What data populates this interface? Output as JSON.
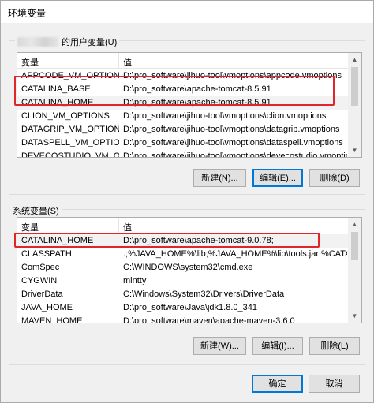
{
  "window": {
    "title": "环境变量"
  },
  "user_section": {
    "group_label": "的用户变量(U)",
    "columns": [
      "变量",
      "值"
    ],
    "rows": [
      {
        "name": "APPCODE_VM_OPTIONS",
        "value": "D:\\pro_software\\jihuo-tool\\vmoptions\\appcode.vmoptions"
      },
      {
        "name": "CATALINA_BASE",
        "value": "D:\\pro_software\\apache-tomcat-8.5.91"
      },
      {
        "name": "CATALINA_HOME",
        "value": "D:\\pro_software\\apache-tomcat-8.5.91"
      },
      {
        "name": "CLION_VM_OPTIONS",
        "value": "D:\\pro_software\\jihuo-tool\\vmoptions\\clion.vmoptions"
      },
      {
        "name": "DATAGRIP_VM_OPTIONS",
        "value": "D:\\pro_software\\jihuo-tool\\vmoptions\\datagrip.vmoptions"
      },
      {
        "name": "DATASPELL_VM_OPTIONS",
        "value": "D:\\pro_software\\jihuo-tool\\vmoptions\\dataspell.vmoptions"
      },
      {
        "name": "DEVECOSTUDIO_VM_OPT...",
        "value": "D:\\pro_software\\jihuo-tool\\vmoptions\\devecostudio.vmoptions"
      }
    ],
    "buttons": {
      "new": "新建(N)...",
      "edit": "编辑(E)...",
      "delete": "删除(D)"
    }
  },
  "system_section": {
    "group_label": "系统变量(S)",
    "columns": [
      "变量",
      "值"
    ],
    "rows": [
      {
        "name": "CATALINA_HOME",
        "value": "D:\\pro_software\\apache-tomcat-9.0.78;"
      },
      {
        "name": "CLASSPATH",
        "value": ".;%JAVA_HOME%\\lib;%JAVA_HOME%\\lib\\tools.jar;%CATALIN..."
      },
      {
        "name": "ComSpec",
        "value": "C:\\WINDOWS\\system32\\cmd.exe"
      },
      {
        "name": "CYGWIN",
        "value": "mintty"
      },
      {
        "name": "DriverData",
        "value": "C:\\Windows\\System32\\Drivers\\DriverData"
      },
      {
        "name": "JAVA_HOME",
        "value": "D:\\pro_software\\Java\\jdk1.8.0_341"
      },
      {
        "name": "MAVEN_HOME",
        "value": "D:\\pro_software\\maven\\apache-maven-3.6.0"
      }
    ],
    "buttons": {
      "new": "新建(W)...",
      "edit": "编辑(I)...",
      "delete": "删除(L)"
    }
  },
  "footer": {
    "ok": "确定",
    "cancel": "取消"
  },
  "colors": {
    "highlight_box": "#e0262b",
    "default_button_border": "#0078d7"
  }
}
